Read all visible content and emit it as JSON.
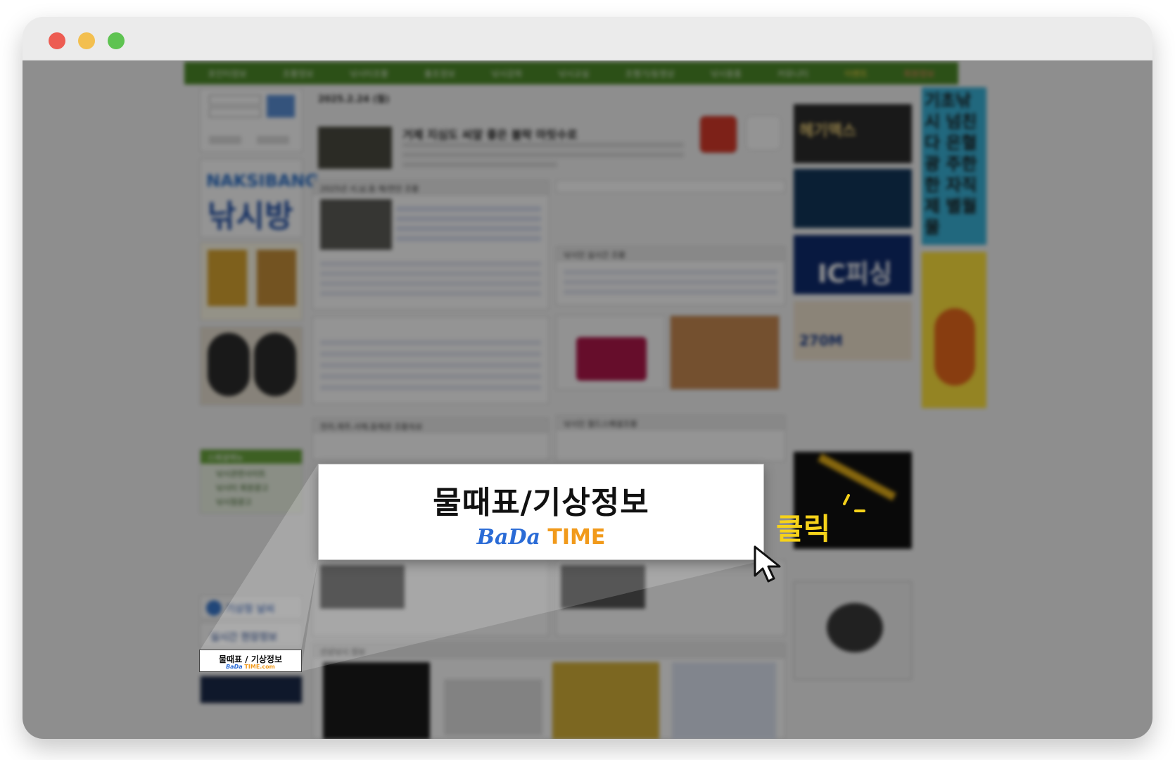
{
  "window": {
    "traffic_lights": [
      "close",
      "minimize",
      "zoom"
    ]
  },
  "site": {
    "nav": [
      "포인터정보",
      "조황정보",
      "낚시터조황",
      "출조정보",
      "낚시강좌",
      "낚시교실",
      "조행기/동영상",
      "낚시용품",
      "커뮤니티",
      "이벤트",
      "회원정보"
    ],
    "date": "2025.2.24 (월)",
    "headline": "거제 지심도 씨알 좋은 볼락 마릿수로",
    "section_west": "2025년 서,남,동 해/연안 조황",
    "section_live": "낚시인 실시간 조황",
    "section_south": "전라,제주,서해,동해권 조황속보",
    "section_weekly": "낚시인 월드스페셜조황",
    "section_bottom": "선상낚시 정보",
    "logo_en": "NAKSIBANG",
    "logo_ko": "낚시방",
    "menu_title": "스페셜메뉴",
    "menu_items": [
      "낚시관련사이트",
      "낚시터 회원광고",
      "낚시점광고"
    ],
    "weather_widget": "기상청 날씨",
    "realtime_widget": "실시간 현장정보",
    "ad_right_tall": "기초낚시 넘친다 은혈광 주한한 자직제 별월물",
    "ad_ic": "IC피싱",
    "ad_270": "270M",
    "ad_max": "헤기맥스"
  },
  "callout": {
    "title": "물때표/기상정보",
    "brand_part1": "BaDa",
    "brand_part2": "TIME"
  },
  "mini_banner": {
    "title": "물때표 / 기상정보",
    "brand_part1": "BaDa",
    "brand_part2": "TIME.com"
  },
  "annotation": {
    "click_label": "클릭"
  },
  "colors": {
    "nav_green": "#4d8a29",
    "bada_blue": "#2a6bd6",
    "time_orange": "#f19a1b",
    "click_yellow": "#f6d21a"
  }
}
